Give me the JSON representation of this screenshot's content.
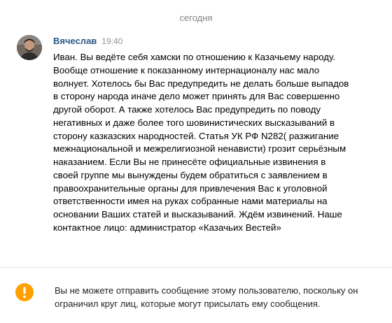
{
  "date_separator": "сегодня",
  "message": {
    "author": "Вячеслав",
    "time": "19:40",
    "text": "Иван. Вы ведёте себя хамски по отношению к Казачьему народу. Вообще отношение к показанному интернационалу нас мало волнует. Хотелось бы Вас предупредить не делать больше выпадов в сторону народа иначе дело может принять для Вас совершенно другой оборот. А также хотелось Вас предупредить по поводу негативных и даже более того шовинистических высказываний в сторону казказских народностей. Статья УК РФ N282( разжигание межнациональной и межрелигиозной ненависти) грозит серьёзным наказанием. Если Вы не принесёте официальные извинения в своей группе мы вынуждены будем обратиться с заявлением в правоохранительные органы для привлечения Вас к уголовной ответственности имея на руках собранные нами материалы на основании Ваших статей и высказываний. Ждём извинений. Наше контактное лицо: администратор «Казачьих Вестей»"
  },
  "notice": {
    "icon": "exclamation-icon",
    "icon_color": "#ffa000",
    "text": "Вы не можете отправить сообщение этому пользователю, поскольку он ограничил круг лиц, которые могут присылать ему сообщения."
  },
  "colors": {
    "author_link": "#2a5885",
    "muted_text": "#828282",
    "divider": "#e7e8ec"
  }
}
